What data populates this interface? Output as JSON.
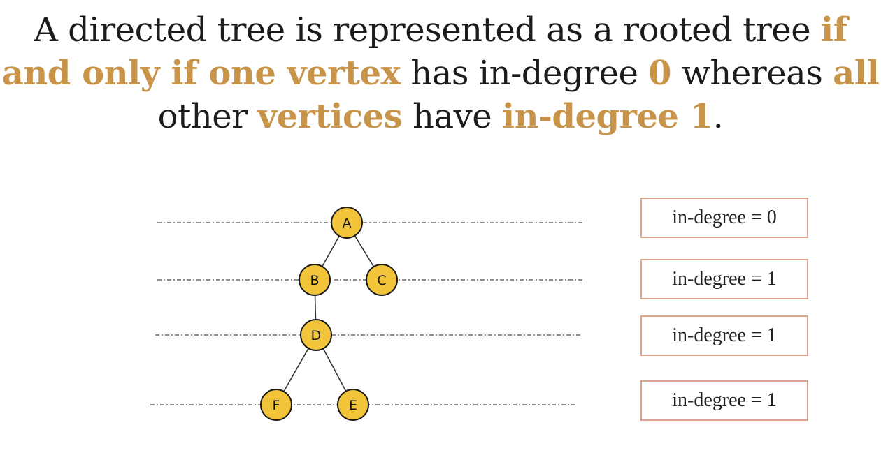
{
  "statement": {
    "segments": [
      {
        "text": "A directed tree is represented as a rooted tree ",
        "highlight": false
      },
      {
        "text": "if and only if one vertex",
        "highlight": true
      },
      {
        "text": " has in-degree ",
        "highlight": false
      },
      {
        "text": "0",
        "highlight": true
      },
      {
        "text": " whereas ",
        "highlight": false
      },
      {
        "text": "all",
        "highlight": true
      },
      {
        "text": " other ",
        "highlight": false
      },
      {
        "text": "vertices",
        "highlight": true
      },
      {
        "text": " have ",
        "highlight": false
      },
      {
        "text": "in-degree 1",
        "highlight": true
      },
      {
        "text": ".",
        "highlight": false
      }
    ]
  },
  "colors": {
    "highlight": "#c8944a",
    "node_fill": "#f2c439",
    "box_border": "#d9a48a"
  },
  "tree": {
    "nodes": [
      {
        "id": "A",
        "label": "A",
        "level": 0
      },
      {
        "id": "B",
        "label": "B",
        "level": 1
      },
      {
        "id": "C",
        "label": "C",
        "level": 1
      },
      {
        "id": "D",
        "label": "D",
        "level": 2
      },
      {
        "id": "F",
        "label": "F",
        "level": 3
      },
      {
        "id": "E",
        "label": "E",
        "level": 3
      }
    ],
    "edges": [
      {
        "from": "A",
        "to": "B"
      },
      {
        "from": "A",
        "to": "C"
      },
      {
        "from": "B",
        "to": "D"
      },
      {
        "from": "D",
        "to": "F"
      },
      {
        "from": "D",
        "to": "E"
      }
    ]
  },
  "degree_labels": [
    {
      "level": 0,
      "text": "in-degree = 0"
    },
    {
      "level": 1,
      "text": "in-degree = 1"
    },
    {
      "level": 2,
      "text": "in-degree = 1"
    },
    {
      "level": 3,
      "text": "in-degree = 1"
    }
  ]
}
